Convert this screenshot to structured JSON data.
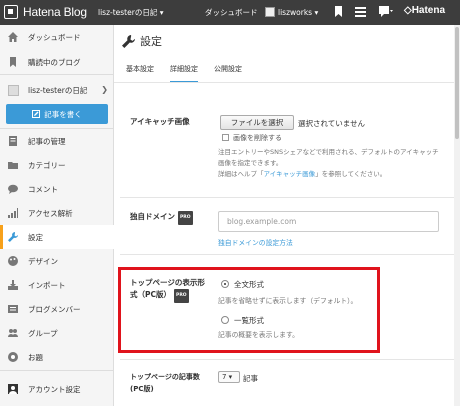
{
  "topbar": {
    "brand": "Hatena Blog",
    "blog_selector": "lisz-testerの日記 ▾",
    "dashboard": "ダッシュボード",
    "user": "liszworks ▾",
    "hatena": "◇Hatena"
  },
  "sidebar": {
    "items": [
      {
        "label": "ダッシュボード",
        "icon": "home-icon"
      },
      {
        "label": "購読中のブログ",
        "icon": "bookmark-icon"
      },
      {
        "label": "lisz-testerの日記",
        "icon": "blog-icon"
      },
      {
        "label": "記事を書く",
        "icon": "pencil-icon"
      },
      {
        "label": "記事の管理",
        "icon": "document-icon"
      },
      {
        "label": "カテゴリー",
        "icon": "folder-icon"
      },
      {
        "label": "コメント",
        "icon": "comment-icon"
      },
      {
        "label": "アクセス解析",
        "icon": "chart-icon"
      },
      {
        "label": "設定",
        "icon": "wrench-icon"
      },
      {
        "label": "デザイン",
        "icon": "palette-icon"
      },
      {
        "label": "インポート",
        "icon": "import-icon"
      },
      {
        "label": "ブログメンバー",
        "icon": "members-icon"
      },
      {
        "label": "グループ",
        "icon": "group-icon"
      },
      {
        "label": "お題",
        "icon": "topic-icon"
      },
      {
        "label": "アカウント設定",
        "icon": "account-icon"
      }
    ]
  },
  "main": {
    "title": "設定",
    "tabs": [
      "基本設定",
      "詳細設定",
      "公開設定"
    ],
    "eyecatch": {
      "label": "アイキャッチ画像",
      "button": "ファイルを選択",
      "status": "選択されていません",
      "checkbox": "画像を削除する",
      "note1": "注目エントリーやSNSシェアなどで利用される、デフォルトのアイキャッチ画像を指定できます。",
      "note2_a": "詳細はヘルプ「",
      "note2_link": "アイキャッチ画像",
      "note2_b": "」を参照してください。"
    },
    "domain": {
      "label": "独自ドメイン",
      "badge": "PRO",
      "placeholder": "blog.example.com",
      "link": "独自ドメインの設定方法"
    },
    "display": {
      "label_line1": "トップページの表示形",
      "label_line2": "式（PC版）",
      "badge": "PRO",
      "options": [
        {
          "label": "全文形式",
          "desc": "記事を省略せずに表示します（デフォルト）。",
          "selected": true
        },
        {
          "label": "一覧形式",
          "desc": "記事の概要を表示します。",
          "selected": false
        }
      ]
    },
    "count": {
      "label_line1": "トップページの記事数",
      "label_line2": "(PC版)",
      "value": "7 ▾",
      "unit": "記事"
    }
  },
  "colors": {
    "accent": "#3b9ad7",
    "highlight": "#e0131c",
    "topbar": "#3d3d3d"
  }
}
